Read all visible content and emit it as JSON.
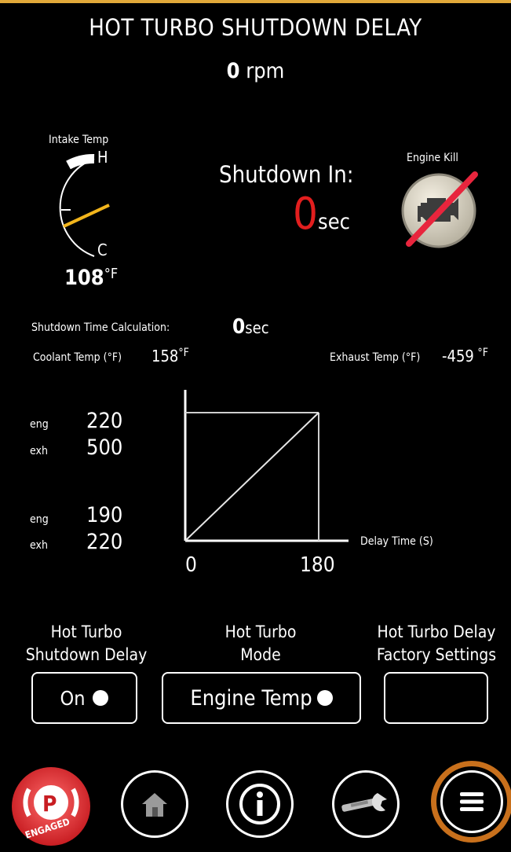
{
  "header": {
    "title": "HOT TURBO SHUTDOWN DELAY",
    "rpm_value": "0",
    "rpm_unit": "rpm"
  },
  "intake_gauge": {
    "label": "Intake Temp",
    "high": "H",
    "low": "C",
    "value": "108",
    "unit": "°F",
    "needle_color": "#f2b51c"
  },
  "shutdown": {
    "label": "Shutdown In:",
    "value": "0",
    "unit": "sec",
    "value_color": "#e21e1e"
  },
  "engine_kill": {
    "label": "Engine Kill",
    "icon": "check-engine-icon"
  },
  "calc": {
    "label": "Shutdown Time Calculation:",
    "value": "0",
    "unit": "sec",
    "coolant_label": "Coolant Temp (°F)",
    "coolant_value": "158",
    "coolant_unit": "°F",
    "exhaust_label": "Exhaust Temp (°F)",
    "exhaust_value": "-459",
    "exhaust_unit": "°F"
  },
  "thresholds": {
    "upper": {
      "eng_label": "eng",
      "eng_value": "220",
      "exh_label": "exh",
      "exh_value": "500"
    },
    "lower": {
      "eng_label": "eng",
      "eng_value": "190",
      "exh_label": "exh",
      "exh_value": "220"
    }
  },
  "delay_graph": {
    "x_label": "Delay Time (S)",
    "x_min": "0",
    "x_max": "180"
  },
  "settings": {
    "shutdown_delay": {
      "label_line1": "Hot Turbo",
      "label_line2": "Shutdown Delay",
      "value": "On"
    },
    "mode": {
      "label_line1": "Hot Turbo",
      "label_line2": "Mode",
      "value": "Engine Temp"
    },
    "factory": {
      "label_line1": "Hot Turbo Delay",
      "label_line2": "Factory Settings"
    }
  },
  "nav": {
    "park_label": "P",
    "park_status": "ENGAGED",
    "park_color": "#e8343a",
    "icons": [
      "home-icon",
      "info-icon",
      "wrench-icon",
      "menu-icon"
    ],
    "menu_ring_color": "#c8701c"
  }
}
